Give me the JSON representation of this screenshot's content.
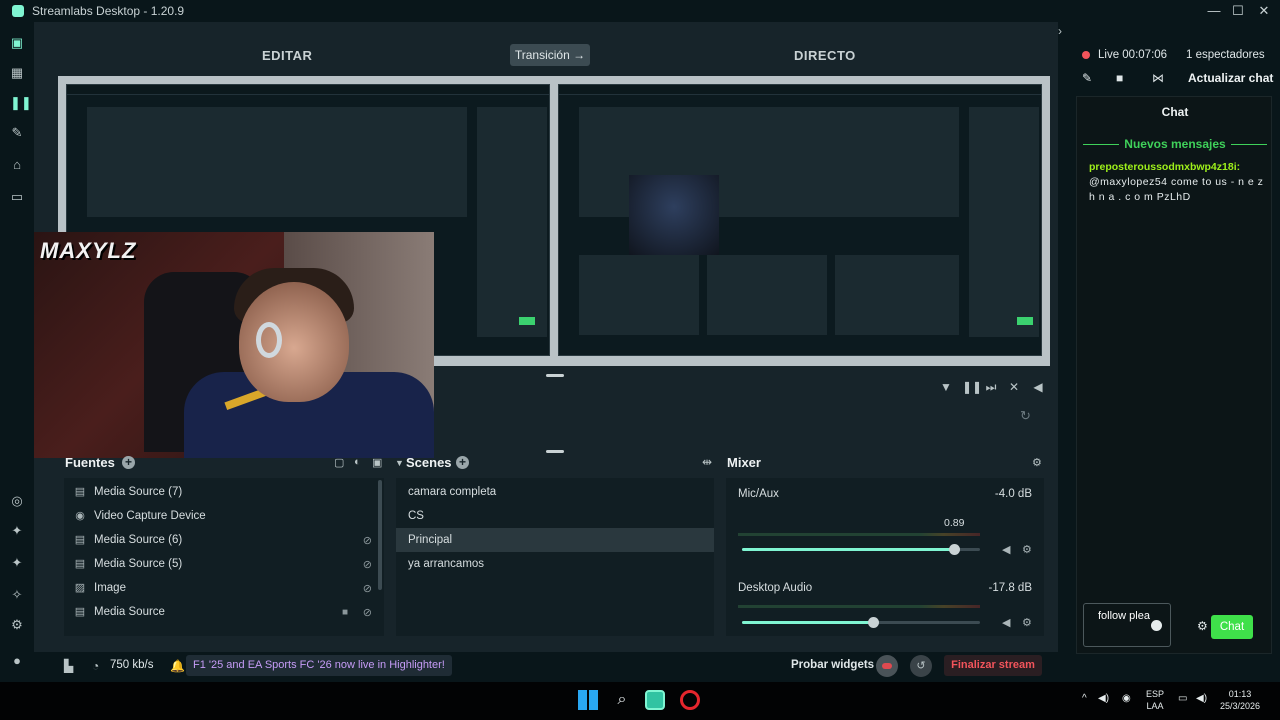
{
  "window": {
    "title": "Streamlabs Desktop - 1.20.9",
    "controls": {
      "minimize": "—",
      "maximize": "☐",
      "close": "✕"
    }
  },
  "editor": {
    "edit_label": "EDITAR",
    "live_label": "DIRECTO",
    "transition_label": "Transición →"
  },
  "sources": {
    "title": "Fuentes",
    "items": [
      {
        "label": "Media Source (7)",
        "icon": "film-icon",
        "hidden": false,
        "locked": false
      },
      {
        "label": "Video Capture Device",
        "icon": "camera-icon",
        "hidden": false,
        "locked": false
      },
      {
        "label": "Media Source (6)",
        "icon": "film-icon",
        "hidden": true,
        "locked": false
      },
      {
        "label": "Media Source (5)",
        "icon": "film-icon",
        "hidden": true,
        "locked": false
      },
      {
        "label": "Image",
        "icon": "image-icon",
        "hidden": true,
        "locked": false
      },
      {
        "label": "Media Source",
        "icon": "film-icon",
        "hidden": true,
        "locked": true
      }
    ]
  },
  "scenes": {
    "title": "Scenes",
    "items": [
      {
        "label": "camara completa",
        "active": false
      },
      {
        "label": "CS",
        "active": false
      },
      {
        "label": "Principal",
        "active": true
      },
      {
        "label": "ya arrancamos",
        "active": false
      }
    ]
  },
  "mixer": {
    "title": "Mixer",
    "channels": [
      {
        "name": "Mic/Aux",
        "db": "-4.0 dB",
        "value_label": "0.89",
        "level": 0.89
      },
      {
        "name": "Desktop Audio",
        "db": "-17.8 dB",
        "level": 0.55
      }
    ]
  },
  "statusbar": {
    "bitrate": "750 kb/s",
    "notification": "F1 '25 and EA Sports FC '26 now live in Highlighter!",
    "test_widgets": "Probar widgets",
    "end_stream": "Finalizar stream"
  },
  "live": {
    "status": "Live 00:07:06",
    "viewers": "1 espectadores",
    "refresh_chat": "Actualizar chat"
  },
  "chat": {
    "title": "Chat",
    "new_messages": "Nuevos mensajes",
    "messages": [
      {
        "user": "preposteroussodmxbwp4z18i:",
        "text": "@maxylopez54 come to us - n e z h n a . c o m PzLhD"
      }
    ],
    "input_value": "follow plea",
    "send_label": "Chat"
  },
  "webcam": {
    "overlay_text": "MAXYLZ"
  },
  "taskbar": {
    "lang_line1": "ESP",
    "lang_line2": "LAA",
    "time": "01:13",
    "date": "25/3/2026"
  },
  "colors": {
    "accent": "#80f5d2",
    "live_red": "#f2545b",
    "chat_user": "#9ef01a",
    "new_messages_green": "#3fd15a",
    "notification_purple": "#c69cf7"
  }
}
